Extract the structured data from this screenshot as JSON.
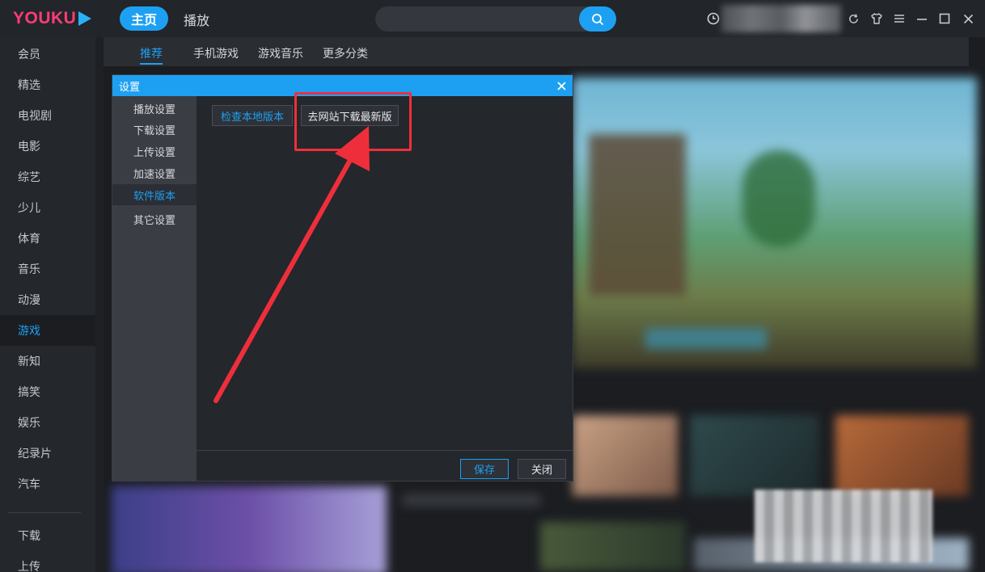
{
  "app": {
    "logo_text": "YOUKU",
    "brand_color": "#ff3d74",
    "accent_color": "#1ea0f2"
  },
  "topbar": {
    "tabs": [
      {
        "label": "主页",
        "active": true
      },
      {
        "label": "播放",
        "active": false
      }
    ],
    "search": {
      "value": "",
      "placeholder": "",
      "icon": "search-icon"
    },
    "icons": [
      "history-clock-icon",
      "refresh-icon",
      "skin-shirt-icon",
      "menu-icon",
      "minimize-icon",
      "maximize-icon",
      "close-icon"
    ]
  },
  "sidebar": {
    "items": [
      {
        "label": "会员"
      },
      {
        "label": "精选"
      },
      {
        "label": "电视剧"
      },
      {
        "label": "电影"
      },
      {
        "label": "综艺"
      },
      {
        "label": "少儿"
      },
      {
        "label": "体育"
      },
      {
        "label": "音乐"
      },
      {
        "label": "动漫"
      },
      {
        "label": "游戏",
        "active": true
      },
      {
        "label": "新知"
      },
      {
        "label": "搞笑"
      },
      {
        "label": "娱乐"
      },
      {
        "label": "纪录片"
      },
      {
        "label": "汽车"
      }
    ],
    "bottom_items": [
      {
        "label": "下载"
      },
      {
        "label": "上传"
      }
    ]
  },
  "subnav": {
    "items": [
      {
        "label": "推荐",
        "active": true
      },
      {
        "label": "手机游戏"
      },
      {
        "label": "游戏音乐"
      },
      {
        "label": "更多分类"
      }
    ]
  },
  "dialog": {
    "title": "设置",
    "menu": [
      {
        "label": "播放设置"
      },
      {
        "label": "下载设置"
      },
      {
        "label": "上传设置"
      },
      {
        "label": "加速设置"
      },
      {
        "label": "软件版本",
        "active": true
      },
      {
        "label": "其它设置"
      }
    ],
    "buttons": {
      "check_local": "检查本地版本",
      "download_latest": "去网站下载最新版",
      "save": "保存",
      "close": "关闭"
    }
  },
  "annotation": {
    "highlight_color": "#ee2f3b"
  }
}
